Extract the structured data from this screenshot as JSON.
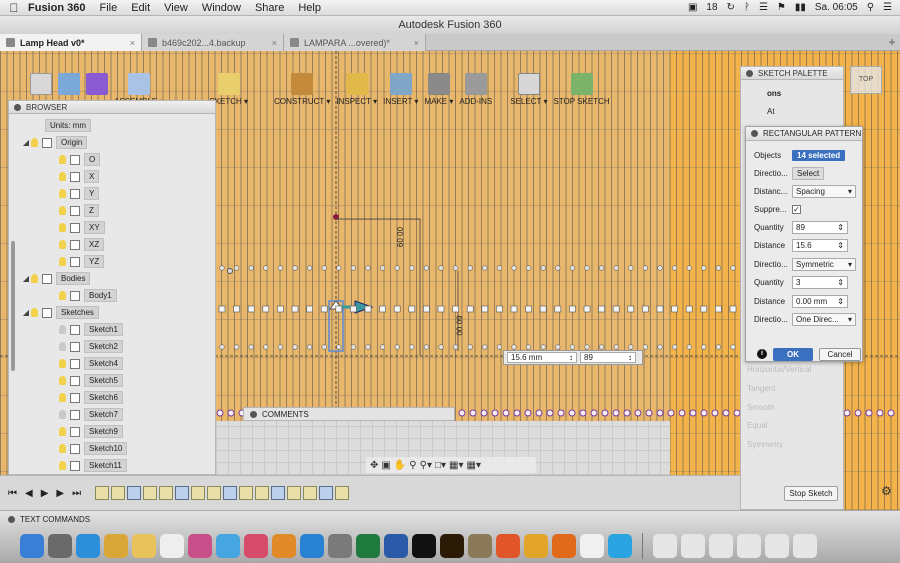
{
  "menubar": {
    "app_name": "Fusion 360",
    "items": [
      "File",
      "Edit",
      "View",
      "Window",
      "Share",
      "Help"
    ],
    "status": {
      "badge": "18",
      "clock": "Sa. 06:05"
    }
  },
  "window": {
    "title": "Autodesk Fusion 360"
  },
  "tabs": [
    {
      "label": "Lamp Head v0*",
      "active": true
    },
    {
      "label": "b469c202...4.backup",
      "active": false
    },
    {
      "label": "LAMPARA ...overed)*",
      "active": false
    }
  ],
  "toolbar": {
    "items": [
      {
        "label": "ASSEMBLE ▾",
        "icon": "assemble-icon",
        "color": "#a9c3e6"
      },
      {
        "label": "SKETCH ▾",
        "icon": "sketch-icon",
        "color": "#e8cf6b"
      },
      {
        "label": "CONSTRUCT ▾",
        "icon": "construct-icon",
        "color": "#c28a3a"
      },
      {
        "label": "INSPECT ▾",
        "icon": "inspect-icon",
        "color": "#e1b94a"
      },
      {
        "label": "INSERT ▾",
        "icon": "insert-icon",
        "color": "#7fa6c7"
      },
      {
        "label": "MAKE ▾",
        "icon": "make-icon",
        "color": "#8a8a8a"
      },
      {
        "label": "ADD-INS",
        "icon": "addins-icon",
        "color": "#9a9a9a"
      },
      {
        "label": "SELECT ▾",
        "icon": "select-icon",
        "color": "#d7d7d7"
      },
      {
        "label": "STOP SKETCH",
        "icon": "stop-sketch-icon",
        "color": "#7cb36a"
      }
    ]
  },
  "browser": {
    "title": "BROWSER",
    "units": "Units: mm",
    "origin_label": "Origin",
    "origin_items": [
      "O",
      "X",
      "Y",
      "Z",
      "XY",
      "XZ",
      "YZ"
    ],
    "bodies_label": "Bodies",
    "body_items": [
      "Body1"
    ],
    "sketches_label": "Sketches",
    "sketch_items": [
      "Sketch1",
      "Sketch2",
      "Sketch4",
      "Sketch5",
      "Sketch6",
      "Sketch7",
      "Sketch9",
      "Sketch10",
      "Sketch11"
    ]
  },
  "comments": {
    "label": "COMMENTS"
  },
  "dimensions": {
    "top": "00.09",
    "side": "00.09"
  },
  "inline_inputs": {
    "distance": "15.6 mm",
    "quantity": "89"
  },
  "sketch_palette": {
    "title": "SKETCH PALETTE",
    "ons": "ons",
    "at": "At",
    "faded_items": [
      "Horizontal/Vertical",
      "Tangent",
      "Smooth",
      "Equal",
      "Symmetry"
    ],
    "stop_sketch": "Stop Sketch"
  },
  "rect_pattern": {
    "title": "RECTANGULAR PATTERN",
    "rows": [
      {
        "label": "Objects",
        "kind": "selected",
        "value": "14 selected"
      },
      {
        "label": "Directio...",
        "kind": "pill",
        "value": "Select"
      },
      {
        "label": "Distanc...",
        "kind": "dropdown",
        "value": "Spacing"
      },
      {
        "label": "Suppre...",
        "kind": "checkbox",
        "value": "✓"
      },
      {
        "label": "Quantity",
        "kind": "number",
        "value": "89"
      },
      {
        "label": "Distance",
        "kind": "number",
        "value": "15.6"
      },
      {
        "label": "Directio...",
        "kind": "dropdown",
        "value": "Symmetric"
      },
      {
        "label": "Quantity",
        "kind": "number",
        "value": "3"
      },
      {
        "label": "Distance",
        "kind": "number",
        "value": "0.00 mm"
      },
      {
        "label": "Directio...",
        "kind": "dropdown",
        "value": "One Direc..."
      }
    ],
    "ok": "OK",
    "cancel": "Cancel"
  },
  "view_cube": {
    "label": "TOP"
  },
  "text_commands": {
    "label": "TEXT COMMANDS"
  },
  "dock": {
    "apps": [
      {
        "name": "finder",
        "color": "#3a7fd6"
      },
      {
        "name": "launchpad",
        "color": "#6a6a6a"
      },
      {
        "name": "safari",
        "color": "#2d8ed9"
      },
      {
        "name": "photos",
        "color": "#d9a63a"
      },
      {
        "name": "notes",
        "color": "#e8c25a"
      },
      {
        "name": "reminders",
        "color": "#eeeeee"
      },
      {
        "name": "photos-app",
        "color": "#c94f8a"
      },
      {
        "name": "messages",
        "color": "#47a6e0"
      },
      {
        "name": "itunes",
        "color": "#d74c6a"
      },
      {
        "name": "ibooks",
        "color": "#e08a2a"
      },
      {
        "name": "appstore",
        "color": "#2a82d2"
      },
      {
        "name": "sysprefs",
        "color": "#7a7a7a"
      },
      {
        "name": "excel",
        "color": "#1f7a3e"
      },
      {
        "name": "word",
        "color": "#2a5aa8"
      },
      {
        "name": "terminal",
        "color": "#111111"
      },
      {
        "name": "illustrator",
        "color": "#2b1a06"
      },
      {
        "name": "gimp",
        "color": "#8a7a5a"
      },
      {
        "name": "fusion",
        "color": "#e0562a"
      },
      {
        "name": "chrome",
        "color": "#e2a52a"
      },
      {
        "name": "firefox",
        "color": "#e06a1a"
      },
      {
        "name": "calendar",
        "color": "#f0f0f0"
      },
      {
        "name": "skype",
        "color": "#2aa4e0"
      }
    ]
  }
}
